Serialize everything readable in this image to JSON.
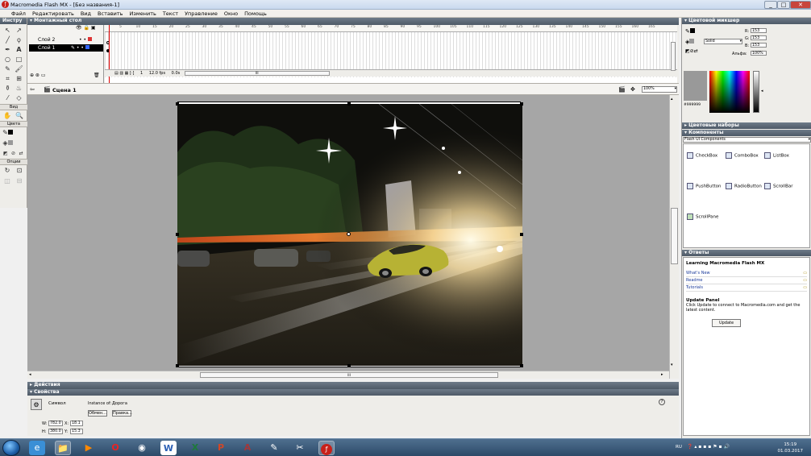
{
  "window": {
    "title": "Macromedia Flash MX - [Без названия-1]",
    "min": "_",
    "max": "□",
    "close": "✕"
  },
  "menu": [
    "Файл",
    "Редактировать",
    "Вид",
    "Вставить",
    "Изменить",
    "Текст",
    "Управление",
    "Окно",
    "Помощь"
  ],
  "tools": {
    "header": "Инстру",
    "view_label": "Вид",
    "colors_label": "Цвета",
    "options_label": "Опции",
    "icons": [
      "arrow-icon",
      "subselect-icon",
      "line-icon",
      "lasso-icon",
      "pen-icon",
      "text-icon",
      "oval-icon",
      "rect-icon",
      "pencil-icon",
      "brush-icon",
      "free-transform-icon",
      "fill-transform-icon",
      "ink-bottle-icon",
      "paint-bucket-icon",
      "eyedropper-icon",
      "eraser-icon"
    ]
  },
  "timeline": {
    "header": "Монтажный стол",
    "layers": [
      {
        "name": "Слой 2",
        "selected": false
      },
      {
        "name": "Слой 1",
        "selected": true
      }
    ],
    "ruler": [
      "5",
      "10",
      "15",
      "20",
      "25",
      "30",
      "35",
      "40",
      "45",
      "50",
      "55",
      "60",
      "65",
      "70",
      "75",
      "80",
      "85",
      "90",
      "95",
      "100",
      "105",
      "110",
      "115",
      "120",
      "125",
      "130",
      "135",
      "140",
      "145",
      "150",
      "155",
      "160",
      "165"
    ],
    "frame": "1",
    "fps": "12.0 fps",
    "time": "0.0s",
    "scrollmark": "III"
  },
  "scene": {
    "name": "Сцена 1",
    "zoom": "100%"
  },
  "panels": {
    "actions": "Действия",
    "properties": "Свойства",
    "color_mixer": "Цветовой микшер",
    "color_swatches": "Цветовые наборы",
    "components": "Компоненты",
    "answers": "Ответы"
  },
  "properties": {
    "type": "Символ",
    "instance_of_label": "Instance of:",
    "instance_of": "Дорога",
    "swap_btn": "Обмен...",
    "edit_btn": "Правка...",
    "w_label": "W:",
    "w": "782.0",
    "h_label": "H:",
    "h": "380.0",
    "x_label": "X:",
    "x": "18.1",
    "y_label": "Y:",
    "y": "15.3"
  },
  "color_mixer": {
    "fill_style": "Solid",
    "r_label": "R:",
    "r": "153",
    "g_label": "G:",
    "g": "153",
    "b_label": "B:",
    "b": "153",
    "alpha_label": "Альфа:",
    "alpha": "100%",
    "hex": "#999999"
  },
  "components": {
    "set": "Flash UI Components",
    "items": [
      "CheckBox",
      "ComboBox",
      "ListBox",
      "PushButton",
      "RadioButton",
      "ScrollBar",
      "ScrollPane"
    ]
  },
  "answers": {
    "title": "Learning Macromedia Flash MX",
    "links": [
      "What's New",
      "Readme",
      "Tutorials"
    ],
    "update_title": "Update Panel",
    "update_text": "Click Update to connect to Macromedia.com and get the latest content.",
    "update_btn": "Update"
  },
  "taskbar": {
    "lang": "RU",
    "time": "15:19",
    "date": "01.03.2017",
    "apps": [
      "ie-icon",
      "explorer-icon",
      "media-player-icon",
      "opera-icon",
      "chrome-icon",
      "word-icon",
      "excel-icon",
      "powerpoint-icon",
      "access-icon",
      "paint-icon",
      "tool-icon",
      "flash-icon"
    ]
  },
  "colors": {
    "accent_red": "#c8201a",
    "panel_header": "#5a6673",
    "stage_gray": "#a6a6a6"
  }
}
